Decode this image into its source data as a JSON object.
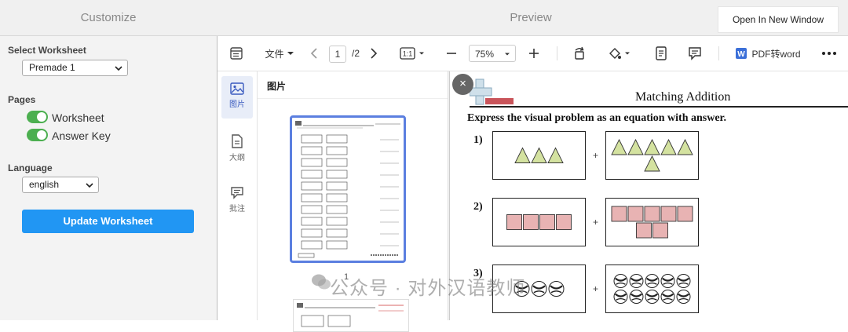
{
  "header": {
    "customize_tab": "Customize",
    "preview_tab": "Preview",
    "open_new_window": "Open In New Window"
  },
  "sidebar": {
    "select_worksheet_label": "Select Worksheet",
    "worksheet_value": "Premade 1",
    "pages_label": "Pages",
    "toggles": [
      {
        "label": "Worksheet",
        "on": true
      },
      {
        "label": "Answer Key",
        "on": true
      }
    ],
    "language_label": "Language",
    "language_value": "english",
    "update_button": "Update Worksheet",
    "toggle_color": "#4caf50",
    "button_color": "#2196f3"
  },
  "viewer": {
    "toolbar": {
      "file_menu": "文件",
      "current_page": "1",
      "total_pages": "/2",
      "zoom": "75%",
      "pdf_to_word": "PDF转word"
    },
    "rail": [
      {
        "label": "图片",
        "icon": "image-icon",
        "active": true
      },
      {
        "label": "大纲",
        "icon": "outline-icon",
        "active": false
      },
      {
        "label": "批注",
        "icon": "comment-icon",
        "active": false
      }
    ],
    "thumbnails_title": "图片",
    "thumbnail_page_number": "1",
    "worksheet": {
      "title": "Matching Addition",
      "instruction": "Express the visual problem as an equation with answer.",
      "problems": [
        {
          "number": "1)",
          "left_count": 3,
          "right_count": 6,
          "shape": "triangle"
        },
        {
          "number": "2)",
          "left_count": 4,
          "right_count": 7,
          "shape": "square"
        },
        {
          "number": "3)",
          "left_count": 3,
          "right_count": 10,
          "shape": "ball"
        }
      ],
      "plus_sign": "+",
      "triangle_color": "#d4e2a0",
      "square_color": "#e8b3b3"
    },
    "watermark": "公众号 · 对外汉语教师"
  }
}
